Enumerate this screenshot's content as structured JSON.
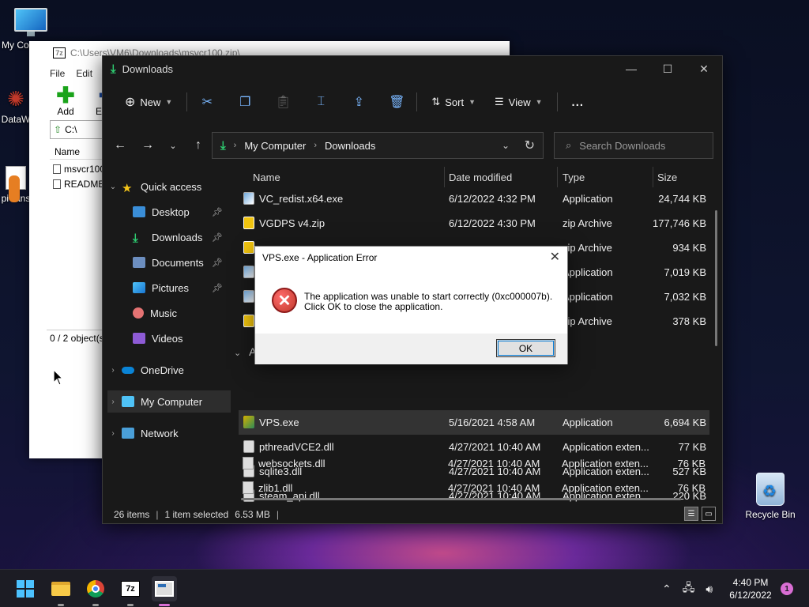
{
  "desktop": {
    "icons": [
      {
        "label": "My Co",
        "icon": "monitor-icon"
      },
      {
        "label": "DataW",
        "icon": "app-icon"
      },
      {
        "label": "pi-rans",
        "icon": "file-icon"
      },
      {
        "label": "Recycle Bin",
        "icon": "recycle-bin-icon"
      }
    ]
  },
  "sevenzip": {
    "title": "C:\\Users\\VM6\\Downloads\\msvcr100.zip\\",
    "menu": [
      "File",
      "Edit"
    ],
    "toolbar": {
      "add": "Add",
      "extract": "Extra"
    },
    "address": "C:\\",
    "list_header": "Name",
    "rows": [
      "msvcr100",
      "README"
    ],
    "status": "0 / 2 object(s"
  },
  "explorer": {
    "title": "Downloads",
    "cmd": {
      "new": "New",
      "sort": "Sort",
      "view": "View",
      "more": "..."
    },
    "breadcrumb": [
      "My Computer",
      "Downloads"
    ],
    "search_placeholder": "Search Downloads",
    "nav": {
      "quick_access": "Quick access",
      "items": [
        "Desktop",
        "Downloads",
        "Documents",
        "Pictures",
        "Music",
        "Videos"
      ],
      "onedrive": "OneDrive",
      "my_computer": "My Computer",
      "network": "Network"
    },
    "columns": {
      "name": "Name",
      "date": "Date modified",
      "type": "Type",
      "size": "Size"
    },
    "files_top": [
      {
        "name": "VC_redist.x64.exe",
        "date": "6/12/2022 4:32 PM",
        "type": "Application",
        "size": "24,744 KB",
        "icon": "exe"
      },
      {
        "name": "VGDPS v4.zip",
        "date": "6/12/2022 4:30 PM",
        "type": "zip Archive",
        "size": "177,746 KB",
        "icon": "zip"
      },
      {
        "name": "",
        "date": "",
        "type": "zip Archive",
        "size": "934 KB",
        "icon": "zip"
      },
      {
        "name": "",
        "date": "",
        "type": "Application",
        "size": "7,019 KB",
        "icon": "exe"
      },
      {
        "name": "",
        "date": "",
        "type": "Application",
        "size": "7,032 KB",
        "icon": "exe"
      },
      {
        "name": "",
        "date": "",
        "type": "zip Archive",
        "size": "378 KB",
        "icon": "zip"
      }
    ],
    "group_label": "A",
    "files_bottom": [
      {
        "name": "VPS.exe",
        "date": "5/16/2021 4:58 AM",
        "type": "Application",
        "size": "6,694 KB",
        "icon": "vps"
      },
      {
        "name": "pthreadVCE2.dll",
        "date": "4/27/2021 10:40 AM",
        "type": "Application exten...",
        "size": "77 KB",
        "icon": "dll"
      },
      {
        "name": "sqlite3.dll",
        "date": "4/27/2021 10:40 AM",
        "type": "Application exten...",
        "size": "527 KB",
        "icon": "dll"
      },
      {
        "name": "steam_api.dll",
        "date": "4/27/2021 10:40 AM",
        "type": "Application exten...",
        "size": "220 KB",
        "icon": "dll"
      },
      {
        "name": "websockets.dll",
        "date": "4/27/2021 10:40 AM",
        "type": "Application exten...",
        "size": "76 KB",
        "icon": "dll"
      },
      {
        "name": "zlib1.dll",
        "date": "4/27/2021 10:40 AM",
        "type": "Application exten...",
        "size": "76 KB",
        "icon": "dll"
      }
    ],
    "status": {
      "items": "26 items",
      "selected": "1 item selected",
      "size": "6.53 MB"
    }
  },
  "dialog": {
    "title": "VPS.exe - Application Error",
    "message_line1": "The application was unable to start correctly (0xc000007b).",
    "message_line2": "Click OK to close the application.",
    "ok": "OK"
  },
  "taskbar": {
    "time": "4:40 PM",
    "date": "6/12/2022",
    "notifications": "1",
    "sevenzip_label": "7z"
  }
}
